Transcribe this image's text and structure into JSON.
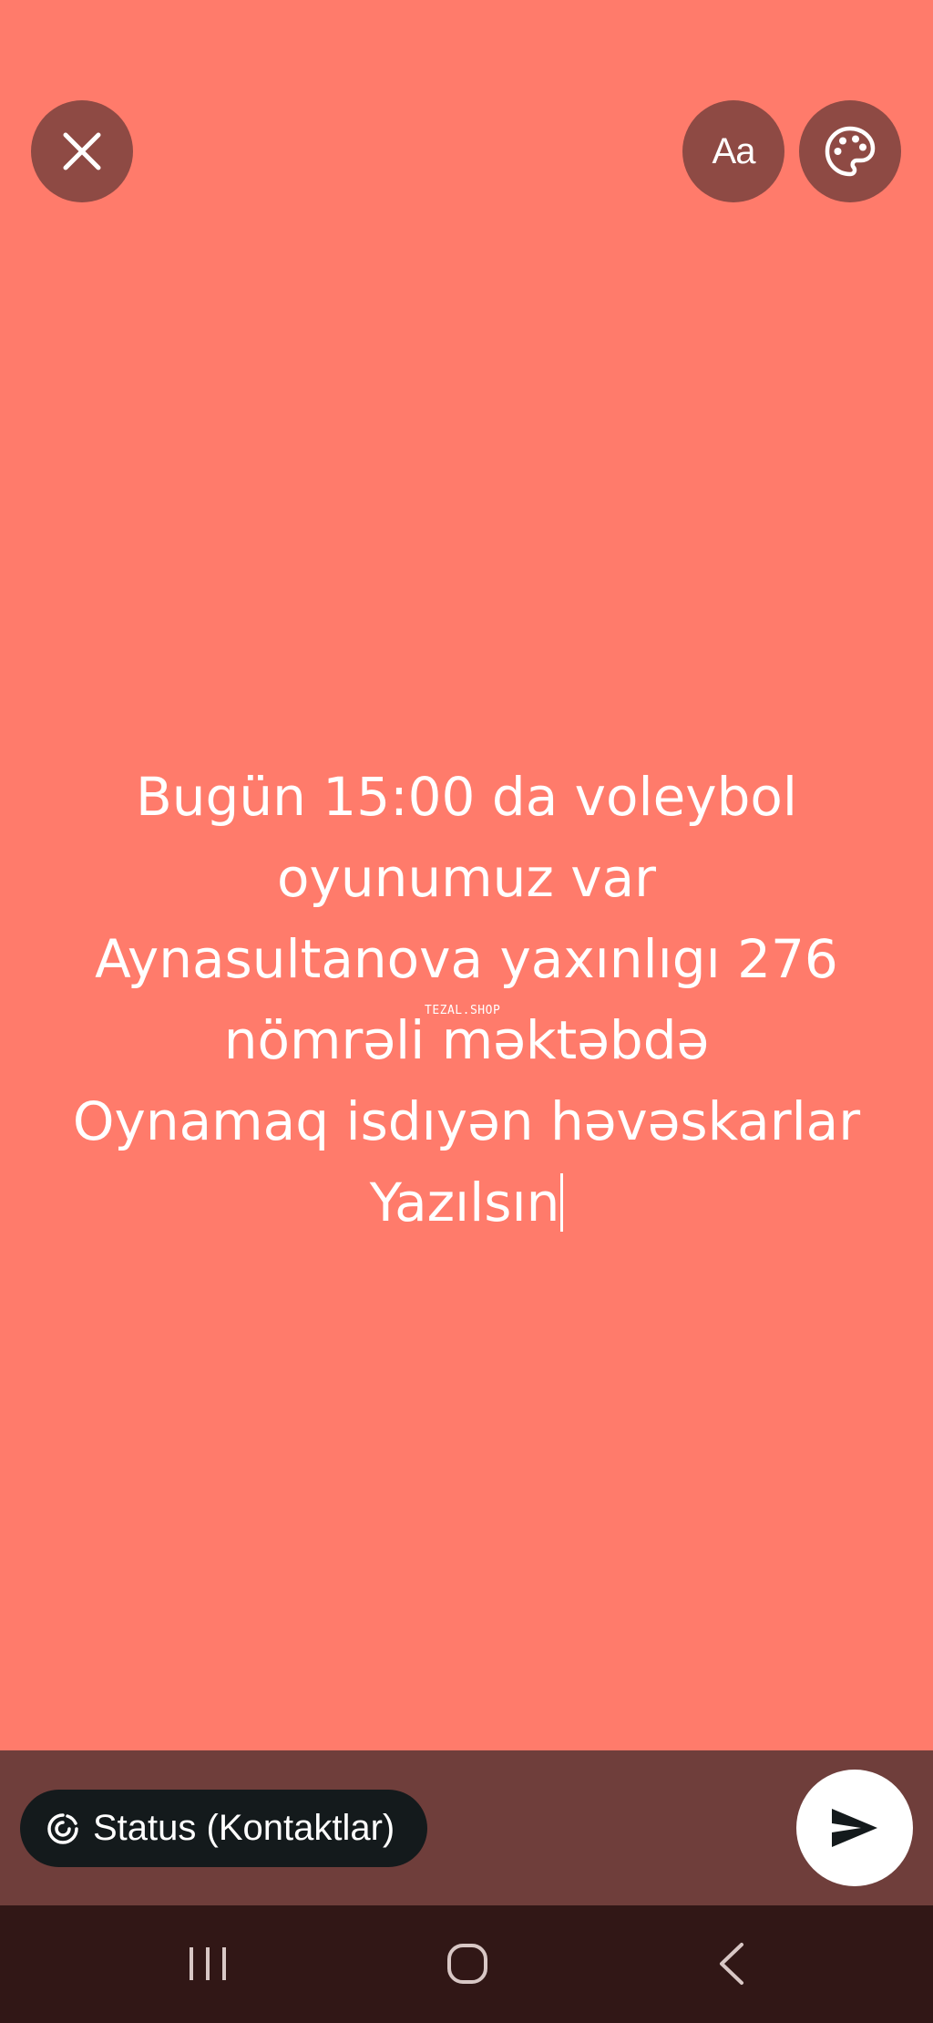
{
  "toolbar": {
    "close_icon": "close-icon",
    "font_button_label": "Aa",
    "palette_icon": "palette-icon"
  },
  "status": {
    "lines": [
      "Bugün 15:00 da voleybol",
      "oyunumuz var",
      "Aynasultanova yaxınlıgı 276",
      "nömrəli məktəbdə",
      "Oynamaq isdıyən həvəskarlar",
      "Yazılsın"
    ],
    "background_color": "#FF7B6B",
    "text_color": "#FFFFFF"
  },
  "watermark": {
    "text": "TEZAL.SHOP"
  },
  "footer": {
    "audience_label": "Status (Kontaktlar)",
    "audience_icon": "status-ring-icon",
    "send_icon": "send-icon"
  },
  "navigation": {
    "recents_icon": "recents-icon",
    "home_icon": "home-icon",
    "back_icon": "back-icon"
  }
}
